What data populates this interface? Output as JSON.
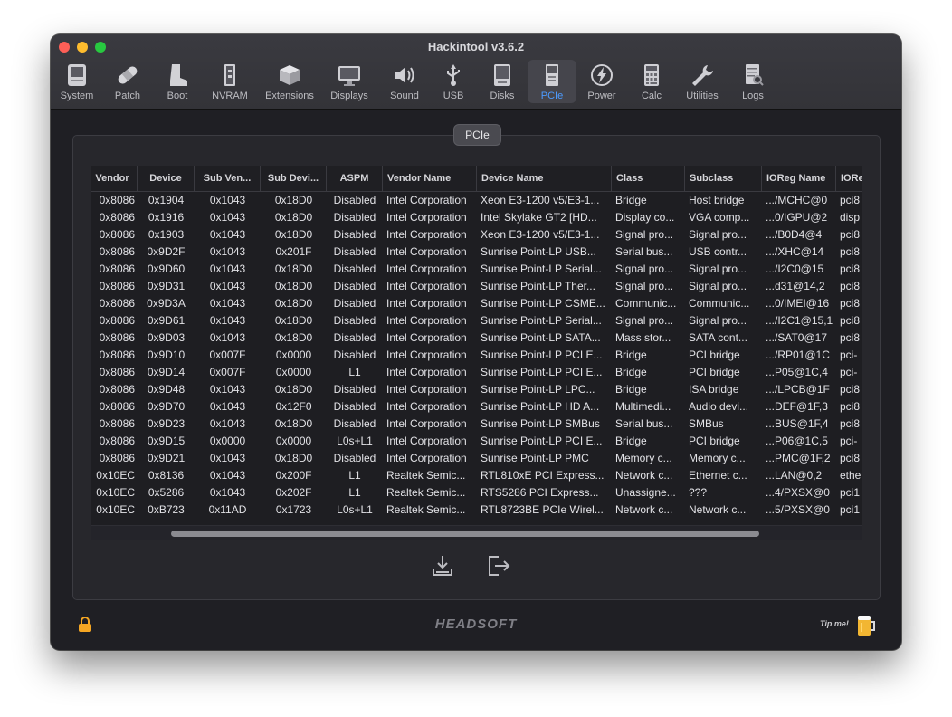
{
  "window": {
    "title": "Hackintool v3.6.2"
  },
  "toolbar": {
    "items": [
      {
        "label": "System",
        "icon": "system-icon"
      },
      {
        "label": "Patch",
        "icon": "bandage-icon"
      },
      {
        "label": "Boot",
        "icon": "boot-icon"
      },
      {
        "label": "NVRAM",
        "icon": "nvram-chip-icon"
      },
      {
        "label": "Extensions",
        "icon": "extensions-box-icon"
      },
      {
        "label": "Displays",
        "icon": "display-icon"
      },
      {
        "label": "Sound",
        "icon": "speaker-icon"
      },
      {
        "label": "USB",
        "icon": "usb-icon"
      },
      {
        "label": "Disks",
        "icon": "disk-icon"
      },
      {
        "label": "PCIe",
        "icon": "pcie-card-icon"
      },
      {
        "label": "Power",
        "icon": "power-bolt-icon"
      },
      {
        "label": "Calc",
        "icon": "calculator-icon"
      },
      {
        "label": "Utilities",
        "icon": "wrench-icon"
      },
      {
        "label": "Logs",
        "icon": "logs-icon"
      }
    ],
    "active": "PCIe",
    "active_color": "#4c9bff"
  },
  "panel": {
    "tab_label": "PCIe"
  },
  "table": {
    "columns": [
      "Vendor",
      "Device",
      "Sub Ven...",
      "Sub Devi...",
      "ASPM",
      "Vendor Name",
      "Device Name",
      "Class",
      "Subclass",
      "IOReg Name",
      "IORe"
    ],
    "rows": [
      [
        "0x8086",
        "0x1904",
        "0x1043",
        "0x18D0",
        "Disabled",
        "Intel Corporation",
        "Xeon E3-1200 v5/E3-1...",
        "Bridge",
        "Host bridge",
        ".../MCHC@0",
        "pci8"
      ],
      [
        "0x8086",
        "0x1916",
        "0x1043",
        "0x18D0",
        "Disabled",
        "Intel Corporation",
        "Intel Skylake GT2 [HD...",
        "Display co...",
        "VGA comp...",
        "...0/IGPU@2",
        "disp"
      ],
      [
        "0x8086",
        "0x1903",
        "0x1043",
        "0x18D0",
        "Disabled",
        "Intel Corporation",
        "Xeon E3-1200 v5/E3-1...",
        "Signal pro...",
        "Signal pro...",
        ".../B0D4@4",
        "pci8"
      ],
      [
        "0x8086",
        "0x9D2F",
        "0x1043",
        "0x201F",
        "Disabled",
        "Intel Corporation",
        "Sunrise Point-LP USB...",
        "Serial bus...",
        "USB contr...",
        ".../XHC@14",
        "pci8"
      ],
      [
        "0x8086",
        "0x9D60",
        "0x1043",
        "0x18D0",
        "Disabled",
        "Intel Corporation",
        "Sunrise Point-LP Serial...",
        "Signal pro...",
        "Signal pro...",
        ".../I2C0@15",
        "pci8"
      ],
      [
        "0x8086",
        "0x9D31",
        "0x1043",
        "0x18D0",
        "Disabled",
        "Intel Corporation",
        "Sunrise Point-LP Ther...",
        "Signal pro...",
        "Signal pro...",
        "...d31@14,2",
        "pci8"
      ],
      [
        "0x8086",
        "0x9D3A",
        "0x1043",
        "0x18D0",
        "Disabled",
        "Intel Corporation",
        "Sunrise Point-LP CSME...",
        "Communic...",
        "Communic...",
        "...0/IMEI@16",
        "pci8"
      ],
      [
        "0x8086",
        "0x9D61",
        "0x1043",
        "0x18D0",
        "Disabled",
        "Intel Corporation",
        "Sunrise Point-LP Serial...",
        "Signal pro...",
        "Signal pro...",
        ".../I2C1@15,1",
        "pci8"
      ],
      [
        "0x8086",
        "0x9D03",
        "0x1043",
        "0x18D0",
        "Disabled",
        "Intel Corporation",
        "Sunrise Point-LP SATA...",
        "Mass stor...",
        "SATA cont...",
        ".../SAT0@17",
        "pci8"
      ],
      [
        "0x8086",
        "0x9D10",
        "0x007F",
        "0x0000",
        "Disabled",
        "Intel Corporation",
        "Sunrise Point-LP PCI E...",
        "Bridge",
        "PCI bridge",
        ".../RP01@1C",
        "pci-"
      ],
      [
        "0x8086",
        "0x9D14",
        "0x007F",
        "0x0000",
        "L1",
        "Intel Corporation",
        "Sunrise Point-LP PCI E...",
        "Bridge",
        "PCI bridge",
        "...P05@1C,4",
        "pci-"
      ],
      [
        "0x8086",
        "0x9D48",
        "0x1043",
        "0x18D0",
        "Disabled",
        "Intel Corporation",
        "Sunrise Point-LP LPC...",
        "Bridge",
        "ISA bridge",
        ".../LPCB@1F",
        "pci8"
      ],
      [
        "0x8086",
        "0x9D70",
        "0x1043",
        "0x12F0",
        "Disabled",
        "Intel Corporation",
        "Sunrise Point-LP HD A...",
        "Multimedi...",
        "Audio devi...",
        "...DEF@1F,3",
        "pci8"
      ],
      [
        "0x8086",
        "0x9D23",
        "0x1043",
        "0x18D0",
        "Disabled",
        "Intel Corporation",
        "Sunrise Point-LP SMBus",
        "Serial bus...",
        "SMBus",
        "...BUS@1F,4",
        "pci8"
      ],
      [
        "0x8086",
        "0x9D15",
        "0x0000",
        "0x0000",
        "L0s+L1",
        "Intel Corporation",
        "Sunrise Point-LP PCI E...",
        "Bridge",
        "PCI bridge",
        "...P06@1C,5",
        "pci-"
      ],
      [
        "0x8086",
        "0x9D21",
        "0x1043",
        "0x18D0",
        "Disabled",
        "Intel Corporation",
        "Sunrise Point-LP PMC",
        "Memory c...",
        "Memory c...",
        "...PMC@1F,2",
        "pci8"
      ],
      [
        "0x10EC",
        "0x8136",
        "0x1043",
        "0x200F",
        "L1",
        "Realtek Semic...",
        "RTL810xE PCI Express...",
        "Network c...",
        "Ethernet c...",
        "...LAN@0,2",
        "ethe"
      ],
      [
        "0x10EC",
        "0x5286",
        "0x1043",
        "0x202F",
        "L1",
        "Realtek Semic...",
        "RTS5286 PCI Express...",
        "Unassigne...",
        "???",
        "...4/PXSX@0",
        "pci1"
      ],
      [
        "0x10EC",
        "0xB723",
        "0x11AD",
        "0x1723",
        "L0s+L1",
        "Realtek Semic...",
        "RTL8723BE PCIe Wirel...",
        "Network c...",
        "Network c...",
        "...5/PXSX@0",
        "pci1"
      ]
    ]
  },
  "actions": {
    "export_icon": "download-icon",
    "exit_icon": "exit-icon"
  },
  "footer": {
    "lock_icon": "lock-icon",
    "brand": "HEADSOFT",
    "tip_label": "Tip me!",
    "beer_icon": "beer-icon",
    "lock_color": "#f5a623"
  }
}
